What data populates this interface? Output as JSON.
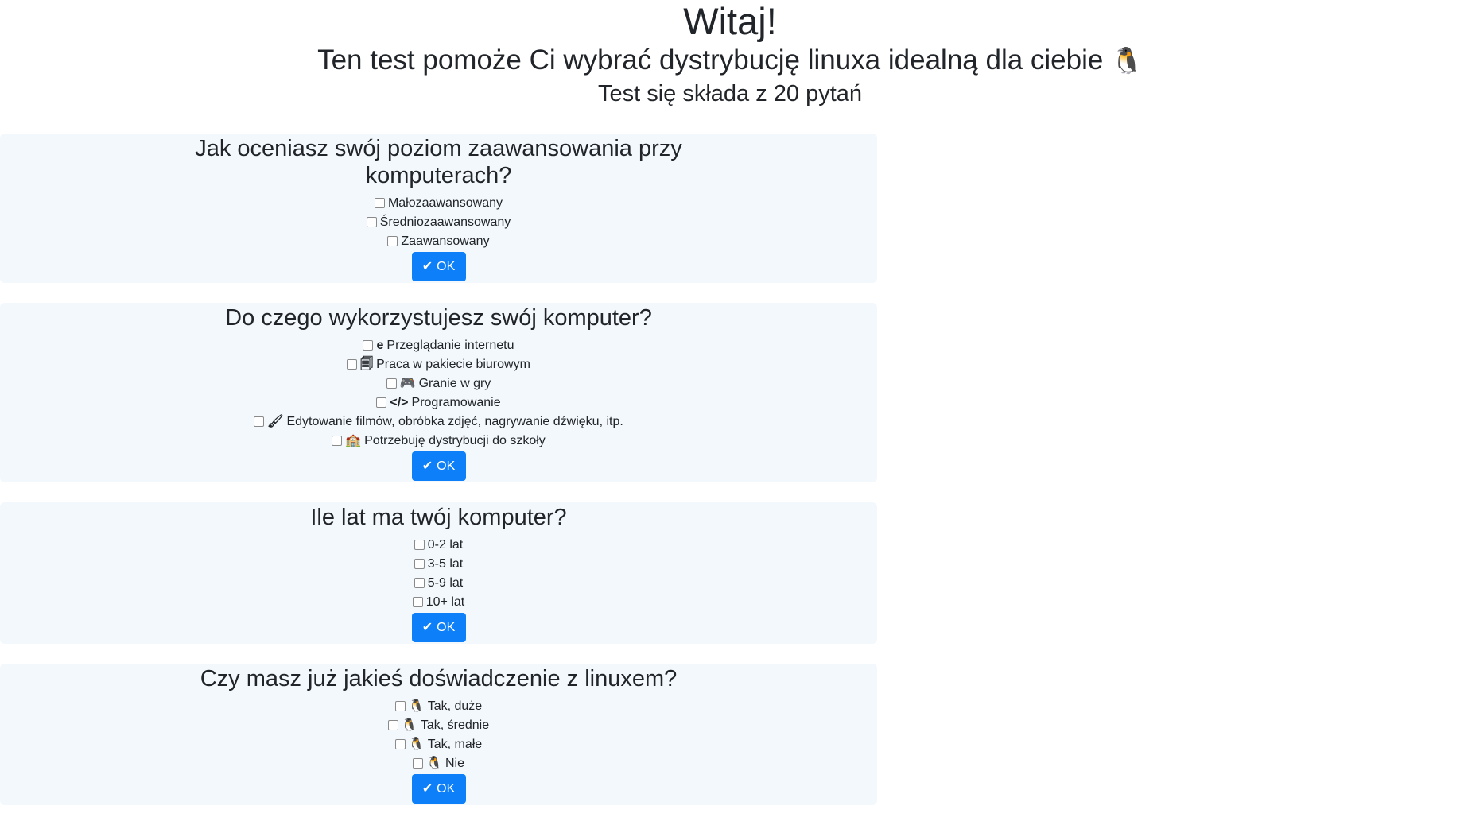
{
  "header": {
    "title": "Witaj!",
    "subtitle": "Ten test pomoże Ci wybrać dystrybucję linuxa idealną dla ciebie",
    "subtitle_icon": "🐧",
    "count": "Test się składa z 20 pytań"
  },
  "ok_label": "OK",
  "questions": [
    {
      "title": "Jak oceniasz swój poziom zaawansowania przy komputerach?",
      "options": [
        {
          "icon": "",
          "label": "Małozaawansowany"
        },
        {
          "icon": "",
          "label": "Średniozaawansowany"
        },
        {
          "icon": "",
          "label": "Zaawansowany"
        }
      ]
    },
    {
      "title": "Do czego wykorzystujesz swój komputer?",
      "options": [
        {
          "icon": "e",
          "label": "Przeglądanie internetu"
        },
        {
          "icon": "🗐",
          "label": "Praca w pakiecie biurowym"
        },
        {
          "icon": "🎮",
          "label": "Granie w gry"
        },
        {
          "icon": "</>",
          "label": "Programowanie"
        },
        {
          "icon": "🖌",
          "label": "Edytowanie filmów, obróbka zdjęć, nagrywanie dźwięku, itp."
        },
        {
          "icon": "🏫",
          "label": "Potrzebuję dystrybucji do szkoły"
        }
      ]
    },
    {
      "title": "Ile lat ma twój komputer?",
      "options": [
        {
          "icon": "",
          "label": "0-2 lat"
        },
        {
          "icon": "",
          "label": "3-5 lat"
        },
        {
          "icon": "",
          "label": "5-9 lat"
        },
        {
          "icon": "",
          "label": "10+ lat"
        }
      ]
    },
    {
      "title": "Czy masz już jakieś doświadczenie z linuxem?",
      "options": [
        {
          "icon": "🐧",
          "label": "Tak, duże"
        },
        {
          "icon": "🐧",
          "label": "Tak, średnie"
        },
        {
          "icon": "🐧",
          "label": "Tak, małe"
        },
        {
          "icon": "🐧",
          "label": "Nie"
        }
      ]
    }
  ],
  "colors": {
    "button": "#0d7ff9",
    "card": "#f3f8fd"
  }
}
